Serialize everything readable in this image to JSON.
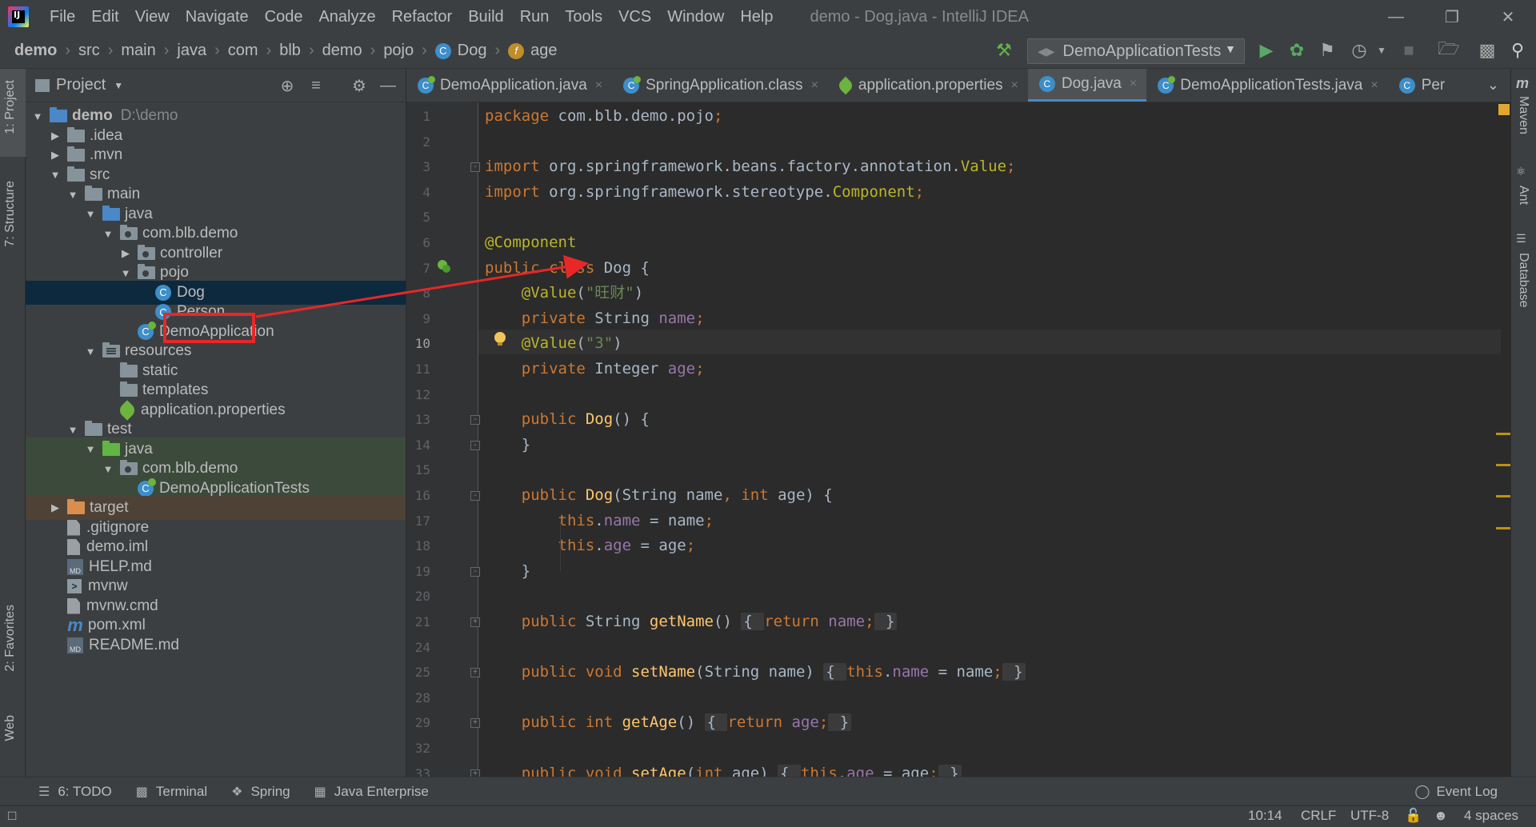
{
  "window": {
    "title": "demo - Dog.java - IntelliJ IDEA",
    "menu": [
      "File",
      "Edit",
      "View",
      "Navigate",
      "Code",
      "Analyze",
      "Refactor",
      "Build",
      "Run",
      "Tools",
      "VCS",
      "Window",
      "Help"
    ]
  },
  "breadcrumbs": [
    "demo",
    "src",
    "main",
    "java",
    "com",
    "blb",
    "demo",
    "pojo",
    "Dog",
    "age"
  ],
  "run_config": "DemoApplicationTests",
  "project_panel": {
    "title": "Project",
    "tree": [
      {
        "label": "demo",
        "extra": "D:\\demo",
        "depth": 0,
        "arrow": "down",
        "icon": "folder-blue",
        "bold": true
      },
      {
        "label": ".idea",
        "depth": 1,
        "arrow": "right",
        "icon": "folder"
      },
      {
        "label": ".mvn",
        "depth": 1,
        "arrow": "right",
        "icon": "folder"
      },
      {
        "label": "src",
        "depth": 1,
        "arrow": "down",
        "icon": "folder"
      },
      {
        "label": "main",
        "depth": 2,
        "arrow": "down",
        "icon": "folder"
      },
      {
        "label": "java",
        "depth": 3,
        "arrow": "down",
        "icon": "folder-blue"
      },
      {
        "label": "com.blb.demo",
        "depth": 4,
        "arrow": "down",
        "icon": "package"
      },
      {
        "label": "controller",
        "depth": 5,
        "arrow": "right",
        "icon": "package"
      },
      {
        "label": "pojo",
        "depth": 5,
        "arrow": "down",
        "icon": "package"
      },
      {
        "label": "Dog",
        "depth": 6,
        "arrow": "none",
        "icon": "class",
        "selected": true
      },
      {
        "label": "Person",
        "depth": 6,
        "arrow": "none",
        "icon": "class"
      },
      {
        "label": "DemoApplication",
        "depth": 5,
        "arrow": "none",
        "icon": "spring-class"
      },
      {
        "label": "resources",
        "depth": 3,
        "arrow": "down",
        "icon": "resources"
      },
      {
        "label": "static",
        "depth": 4,
        "arrow": "none",
        "icon": "folder"
      },
      {
        "label": "templates",
        "depth": 4,
        "arrow": "none",
        "icon": "folder"
      },
      {
        "label": "application.properties",
        "depth": 4,
        "arrow": "none",
        "icon": "leaf"
      },
      {
        "label": "test",
        "depth": 2,
        "arrow": "down",
        "icon": "folder"
      },
      {
        "label": "java",
        "depth": 3,
        "arrow": "down",
        "icon": "folder-green",
        "bg": "green"
      },
      {
        "label": "com.blb.demo",
        "depth": 4,
        "arrow": "down",
        "icon": "package",
        "bg": "green"
      },
      {
        "label": "DemoApplicationTests",
        "depth": 5,
        "arrow": "none",
        "icon": "spring-class",
        "bg": "green"
      },
      {
        "label": "target",
        "depth": 1,
        "arrow": "right",
        "icon": "folder-orange",
        "bg": "orange"
      },
      {
        "label": ".gitignore",
        "depth": 1,
        "arrow": "none",
        "icon": "file"
      },
      {
        "label": "demo.iml",
        "depth": 1,
        "arrow": "none",
        "icon": "file"
      },
      {
        "label": "HELP.md",
        "depth": 1,
        "arrow": "none",
        "icon": "md"
      },
      {
        "label": "mvnw",
        "depth": 1,
        "arrow": "none",
        "icon": "terminal"
      },
      {
        "label": "mvnw.cmd",
        "depth": 1,
        "arrow": "none",
        "icon": "file"
      },
      {
        "label": "pom.xml",
        "depth": 1,
        "arrow": "none",
        "icon": "maven"
      },
      {
        "label": "README.md",
        "depth": 1,
        "arrow": "none",
        "icon": "md"
      }
    ]
  },
  "tabs": [
    {
      "label": "DemoApplication.java",
      "icon": "spring-class",
      "active": false
    },
    {
      "label": "SpringApplication.class",
      "icon": "spring-class",
      "active": false
    },
    {
      "label": "application.properties",
      "icon": "leaf",
      "active": false
    },
    {
      "label": "Dog.java",
      "icon": "class",
      "active": true
    },
    {
      "label": "DemoApplicationTests.java",
      "icon": "spring-class",
      "active": false
    },
    {
      "label": "Per",
      "icon": "class",
      "active": false
    }
  ],
  "editor": {
    "current_line": 10,
    "lines": [
      {
        "n": 1,
        "tokens": [
          [
            "kw",
            "package "
          ],
          [
            "plain",
            "com.blb.demo.pojo"
          ],
          [
            "kw",
            ";"
          ]
        ]
      },
      {
        "n": 2,
        "tokens": []
      },
      {
        "n": 3,
        "tokens": [
          [
            "kw",
            "import "
          ],
          [
            "plain",
            "org.springframework.beans.factory.annotation."
          ],
          [
            "ann",
            "Value"
          ],
          [
            "kw",
            ";"
          ]
        ]
      },
      {
        "n": 4,
        "tokens": [
          [
            "kw",
            "import "
          ],
          [
            "plain",
            "org.springframework.stereotype."
          ],
          [
            "ann",
            "Component"
          ],
          [
            "kw",
            ";"
          ]
        ]
      },
      {
        "n": 5,
        "tokens": []
      },
      {
        "n": 6,
        "tokens": [
          [
            "ann",
            "@Component"
          ]
        ]
      },
      {
        "n": 7,
        "tokens": [
          [
            "kw",
            "public class "
          ],
          [
            "plain",
            "Dog {"
          ]
        ]
      },
      {
        "n": 8,
        "tokens": [
          [
            "plain",
            "    "
          ],
          [
            "ann",
            "@Value"
          ],
          [
            "plain",
            "("
          ],
          [
            "str",
            "\"旺财\""
          ],
          [
            "plain",
            ")"
          ]
        ]
      },
      {
        "n": 9,
        "tokens": [
          [
            "plain",
            "    "
          ],
          [
            "kw",
            "private "
          ],
          [
            "plain",
            "String "
          ],
          [
            "field",
            "name"
          ],
          [
            "kw",
            ";"
          ]
        ]
      },
      {
        "n": 10,
        "tokens": [
          [
            "plain",
            "    "
          ],
          [
            "ann",
            "@Value"
          ],
          [
            "plain",
            "("
          ],
          [
            "str",
            "\"3\""
          ],
          [
            "plain",
            ")"
          ]
        ]
      },
      {
        "n": 11,
        "tokens": [
          [
            "plain",
            "    "
          ],
          [
            "kw",
            "private "
          ],
          [
            "plain",
            "Integer "
          ],
          [
            "field",
            "age"
          ],
          [
            "kw",
            ";"
          ]
        ]
      },
      {
        "n": 12,
        "tokens": []
      },
      {
        "n": 13,
        "tokens": [
          [
            "plain",
            "    "
          ],
          [
            "kw",
            "public "
          ],
          [
            "fn",
            "Dog"
          ],
          [
            "plain",
            "() {"
          ]
        ]
      },
      {
        "n": 14,
        "tokens": [
          [
            "plain",
            "    }"
          ]
        ]
      },
      {
        "n": 15,
        "tokens": []
      },
      {
        "n": 16,
        "tokens": [
          [
            "plain",
            "    "
          ],
          [
            "kw",
            "public "
          ],
          [
            "fn",
            "Dog"
          ],
          [
            "plain",
            "(String name"
          ],
          [
            "kw",
            ", int "
          ],
          [
            "plain",
            "age) {"
          ]
        ]
      },
      {
        "n": 17,
        "tokens": [
          [
            "plain",
            "        "
          ],
          [
            "kw",
            "this"
          ],
          [
            "plain",
            "."
          ],
          [
            "field",
            "name"
          ],
          [
            "plain",
            " = name"
          ],
          [
            "kw",
            ";"
          ]
        ]
      },
      {
        "n": 18,
        "tokens": [
          [
            "plain",
            "        "
          ],
          [
            "kw",
            "this"
          ],
          [
            "plain",
            "."
          ],
          [
            "field",
            "age"
          ],
          [
            "plain",
            " = age"
          ],
          [
            "kw",
            ";"
          ]
        ]
      },
      {
        "n": 19,
        "tokens": [
          [
            "plain",
            "    }"
          ]
        ]
      },
      {
        "n": 20,
        "tokens": []
      },
      {
        "n": 21,
        "tokens": [
          [
            "plain",
            "    "
          ],
          [
            "kw",
            "public "
          ],
          [
            "plain",
            "String "
          ],
          [
            "fn",
            "getName"
          ],
          [
            "plain",
            "() "
          ],
          [
            "fold",
            "{ "
          ],
          [
            "kw",
            "return "
          ],
          [
            "field",
            "name"
          ],
          [
            "kw",
            ";"
          ],
          [
            "fold",
            " }"
          ]
        ]
      },
      {
        "n": 24,
        "tokens": []
      },
      {
        "n": 25,
        "tokens": [
          [
            "plain",
            "    "
          ],
          [
            "kw",
            "public void "
          ],
          [
            "fn",
            "setName"
          ],
          [
            "plain",
            "(String name) "
          ],
          [
            "fold",
            "{ "
          ],
          [
            "kw",
            "this"
          ],
          [
            "plain",
            "."
          ],
          [
            "field",
            "name"
          ],
          [
            "plain",
            " = name"
          ],
          [
            "kw",
            ";"
          ],
          [
            "fold",
            " }"
          ]
        ]
      },
      {
        "n": 28,
        "tokens": []
      },
      {
        "n": 29,
        "tokens": [
          [
            "plain",
            "    "
          ],
          [
            "kw",
            "public int "
          ],
          [
            "fn",
            "getAge"
          ],
          [
            "plain",
            "() "
          ],
          [
            "fold",
            "{ "
          ],
          [
            "kw",
            "return "
          ],
          [
            "field",
            "age"
          ],
          [
            "kw",
            ";"
          ],
          [
            "fold",
            " }"
          ]
        ]
      },
      {
        "n": 32,
        "tokens": []
      },
      {
        "n": 33,
        "tokens": [
          [
            "plain",
            "    "
          ],
          [
            "kw",
            "public void "
          ],
          [
            "fn",
            "setAge"
          ],
          [
            "plain",
            "("
          ],
          [
            "kw",
            "int "
          ],
          [
            "plain",
            "age) "
          ],
          [
            "fold",
            "{ "
          ],
          [
            "kw",
            "this"
          ],
          [
            "plain",
            "."
          ],
          [
            "field",
            "age"
          ],
          [
            "plain",
            " = age"
          ],
          [
            "kw",
            ";"
          ],
          [
            "fold",
            " }"
          ]
        ]
      }
    ]
  },
  "left_strip": [
    "1: Project",
    "7: Structure",
    "2: Favorites",
    "Web"
  ],
  "right_strip": [
    "Maven",
    "Ant",
    "Database"
  ],
  "bottom_tools": [
    "6: TODO",
    "Terminal",
    "Spring",
    "Java Enterprise"
  ],
  "event_log": "Event Log",
  "status": {
    "position": "10:14",
    "line_sep": "CRLF",
    "encoding": "UTF-8",
    "indent": "4 spaces"
  },
  "colors": {
    "annotation_box": "#e82727",
    "arrow": "#e82727"
  }
}
